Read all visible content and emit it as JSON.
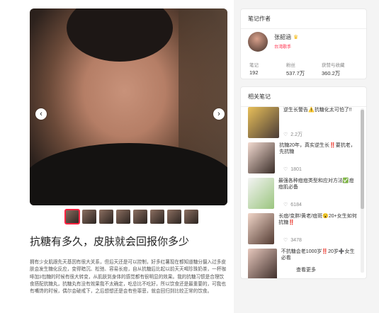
{
  "post": {
    "title": "抗糖有多久，皮肤就会回报你多少",
    "body": "拥有少女肌跟先天基因有很大关系，但后天还是可以控制，好多红薯现在都知道糖分摄入过多皮肤会发生糖化反应，变得暗沉、松弛、容易长痘，自从抗糖后比起以前天天喝珍珠奶茶，一杯咖啡加3包糖的时候有很大转变，从肌肤到身体的感觉都有很明显的效果。我的抗糖习惯是合理饮食搭配抗糖丸，抗糖丸有没有效果我不太确定，吃总比不吃好，所以饮食还是最重要的，可我也有嘴馋的时候，偶尔会破戒下，之后想想还是会有些罪恶，就会回归到比较正常的饮食。",
    "nav_prev_icon": "chevron-left-icon",
    "nav_next_icon": "chevron-right-icon",
    "prev_glyph": "‹",
    "next_glyph": "›",
    "thumb_count": 8
  },
  "author": {
    "panel_title": "笔记作者",
    "name": "张韶涵",
    "badge_icon": "crown-icon",
    "badge_glyph": "♛",
    "role": "台湾歌手",
    "stats": [
      {
        "label": "笔记",
        "value": "192"
      },
      {
        "label": "粉丝",
        "value": "537.7万"
      },
      {
        "label": "获赞与收藏",
        "value": "360.2万"
      }
    ]
  },
  "related": {
    "panel_title": "相关笔记",
    "heart_glyph": "♡",
    "items": [
      {
        "title": "逆生长警告⚠️抗糖化太可怕了!!",
        "likes": "2.2万"
      },
      {
        "title": "抗糖20年，真实逆生长‼️要抗老，先抗糖",
        "likes": "1801"
      },
      {
        "title": "最强各种痘痘类型和应对方法✅痘痘肌必备",
        "likes": "6184"
      },
      {
        "title": "长痘/变胖/黄老/痘斑😮20+女生如何抗糖‼️",
        "likes": "3478"
      },
      {
        "title": "不抗糖会老1000岁‼️20岁➕女生必看",
        "likes": ""
      }
    ],
    "see_more": "查看更多"
  },
  "colors": {
    "accent": "#ff2442",
    "crown": "#f3b400"
  }
}
